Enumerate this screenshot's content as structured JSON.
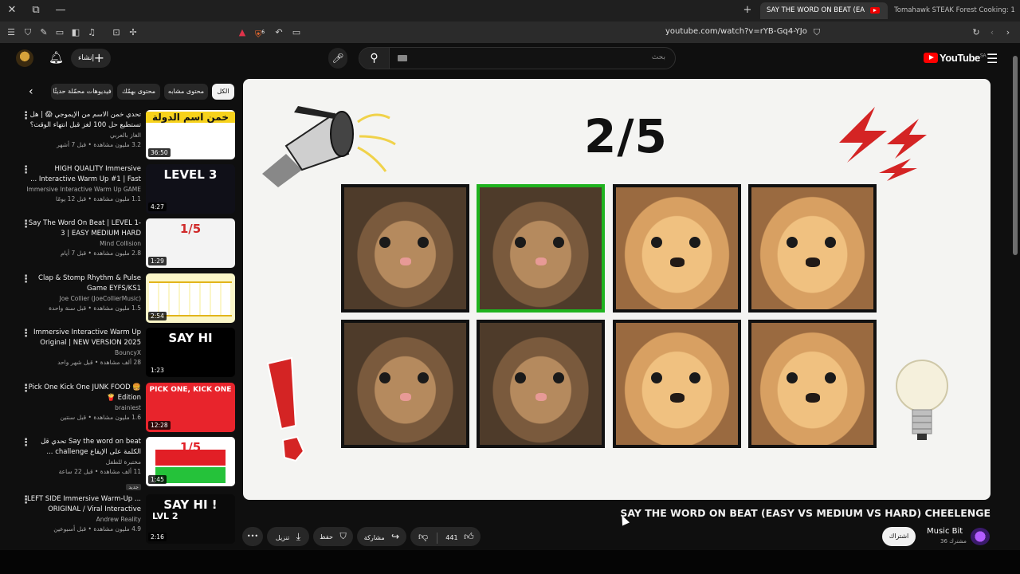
{
  "browser": {
    "tabs": [
      {
        "label": "SAY THE WORD ON BEAT (EA",
        "active": true
      },
      {
        "label": "Tomahawk STEAK Forest Cooking: 1",
        "active": false
      }
    ],
    "shield_badge": "6",
    "url": "youtube.com/watch?v=rYB-Gq4-YJo"
  },
  "header": {
    "create_label": "إنشاء",
    "search_placeholder": "بحث",
    "logo_text": "YouTube",
    "logo_region": "SA"
  },
  "chips": [
    {
      "label": "الكل",
      "selected": true
    },
    {
      "label": "محتوى مشابه",
      "selected": false
    },
    {
      "label": "محتوى بهمّك",
      "selected": false
    },
    {
      "label": "فيديوهات محمّلة حديثًا",
      "selected": false
    }
  ],
  "sidebar": {
    "items": [
      {
        "title": "تحدي خمن الاسم من الإيموجي 😱 | هل تستطيع حل 100 لغز قبل انتهاء الوقت؟",
        "channel": "الغاز بالعربي",
        "views": "3.2 مليون مشاهدة • قبل 7 أشهر",
        "duration": "36:50",
        "thumb_text": "خمن اسم الدولة",
        "thumb_bg": "#ffffff",
        "thumb_accent": "#f7d21c"
      },
      {
        "title": "HIGH QUALITY Immersive Interactive Warm Up #1 | Fast ...",
        "channel": "Immersive Interactive Warm Up GAME",
        "views": "1.1 مليون مشاهدة • قبل 12 يومًا",
        "duration": "4:27",
        "thumb_text": "LEVEL 3",
        "thumb_bg": "#101018",
        "thumb_accent": "#ffffff"
      },
      {
        "title": "Say The Word On Beat | LEVEL 1-3 | EASY MEDIUM HARD",
        "channel": "Mind Collision",
        "views": "2.8 مليون مشاهدة • قبل 7 أيام",
        "duration": "1:29",
        "thumb_text": "1/5",
        "thumb_bg": "#f3f3f3",
        "thumb_accent": "#d02b2b"
      },
      {
        "title": "Clap & Stomp Rhythm & Pulse Game EYFS/KS1",
        "channel": "Joe Collier (JoeCollierMusic)",
        "views": "1.5 مليون مشاهدة • قبل سنة واحدة",
        "duration": "2:54",
        "thumb_text": "",
        "thumb_bg": "#fbf6c8",
        "thumb_accent": "#e2b51c"
      },
      {
        "title": "Immersive Interactive Warm Up Original | NEW VERSION 2025",
        "channel": "BouncyX",
        "views": "28 ألف مشاهدة • قبل شهر واحد",
        "duration": "1:23",
        "thumb_text": "SAY HI",
        "thumb_bg": "#000000",
        "thumb_accent": "#ffffff"
      },
      {
        "title": "🍔 Pick One Kick One JUNK FOOD Edition 🍟",
        "channel": "brainiest",
        "views": "1.6 مليون مشاهدة • قبل سنتين",
        "duration": "12:28",
        "thumb_text": "PICK ONE, KICK ONE",
        "thumb_bg": "#e8242c",
        "thumb_accent": "#ffffff"
      },
      {
        "title": "Say the word on beat تحدي قل الكلمة على الإيقاع challenge ...",
        "channel": "مختبرة للطفل",
        "views": "11 ألف مشاهدة • قبل 22 ساعة",
        "duration": "1:45",
        "thumb_text": "1/5",
        "thumb_bg": "#ffffff",
        "thumb_accent": "#e21f26",
        "badge": "جديد"
      },
      {
        "title": "LEFT SIDE Immersive Warm-Up ... ORIGINAL / Viral Interactive",
        "channel": "Andrew Reality",
        "views": "4.9 مليون مشاهدة • قبل أسبوعين",
        "duration": "2:16",
        "thumb_text": "SAY HI !",
        "thumb_bg": "#0a0a0a",
        "thumb_accent": "#ffffff",
        "thumb_text2": "LVL 2"
      }
    ]
  },
  "video": {
    "counter": "2/5",
    "grid": [
      {
        "animal": "cat",
        "highlight": false
      },
      {
        "animal": "cat",
        "highlight": true
      },
      {
        "animal": "dog",
        "highlight": false
      },
      {
        "animal": "dog",
        "highlight": false
      },
      {
        "animal": "cat",
        "highlight": false
      },
      {
        "animal": "cat",
        "highlight": false
      },
      {
        "animal": "dog",
        "highlight": false
      },
      {
        "animal": "dog",
        "highlight": false
      }
    ],
    "title": "SAY THE WORD ON BEAT (EASY VS MEDIUM VS HARD) CHEELENGE"
  },
  "actions": {
    "likes": "441",
    "share_label": "مشاركة",
    "save_label": "حفظ",
    "download_label": "تنزيل",
    "more_label": "•••"
  },
  "channel": {
    "name": "Music Bit",
    "subscribers": "36 مشترك",
    "subscribe_label": "اشتراك"
  },
  "colors": {
    "background": "#0f0f0f",
    "highlight": "#1fb31f",
    "brand_red": "#ff0000"
  }
}
